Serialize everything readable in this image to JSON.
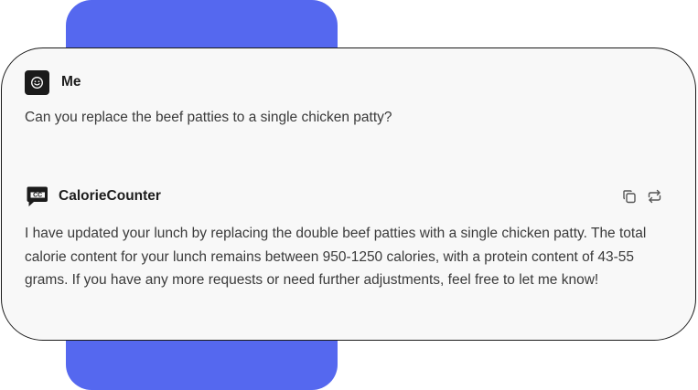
{
  "user_message": {
    "sender": "Me",
    "avatar_icon": "smiley-face-icon",
    "text": "Can you replace the beef patties to a single chicken patty?"
  },
  "assistant_message": {
    "sender": "CalorieCounter",
    "avatar_icon": "chat-bubble-cc-icon",
    "avatar_label": "CC",
    "text": "I have updated your lunch by replacing the double beef patties with a single chicken patty. The total calorie content for your lunch remains between 950-1250 calories, with a protein content of 43-55 grams. If you have any more requests or need further adjustments, feel free to let me know!",
    "actions": [
      {
        "icon": "copy-icon"
      },
      {
        "icon": "regenerate-icon"
      }
    ]
  },
  "colors": {
    "accent": "#5568ef",
    "card_background": "#f8f8f8",
    "card_border": "#1a1a1a",
    "text": "#3a3a3a"
  }
}
